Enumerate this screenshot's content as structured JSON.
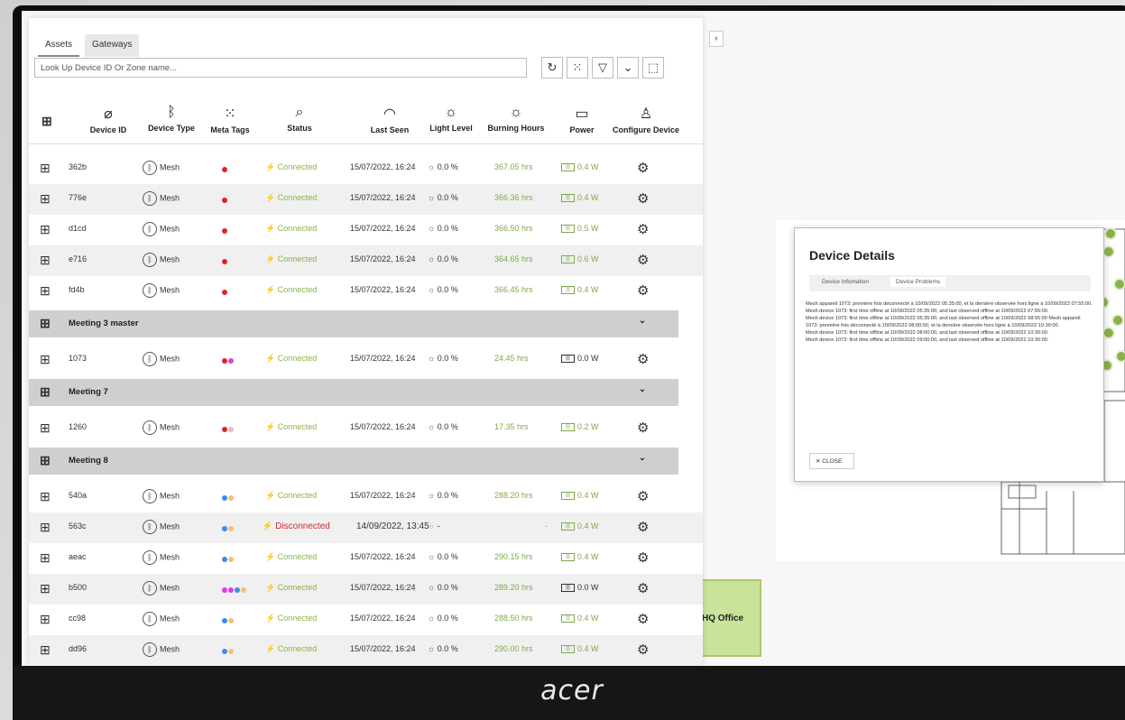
{
  "tabs": [
    "Assets",
    "Gateways"
  ],
  "search": {
    "placeholder": "Look Up Device ID Or Zone name..."
  },
  "columns": [
    "Device ID",
    "Device Type",
    "Meta Tags",
    "Status",
    "Last Seen",
    "Light Level",
    "Burning Hours",
    "Power",
    "Configure Device"
  ],
  "rows": [
    {
      "id": "362b",
      "type": "Mesh",
      "status": "Connected",
      "seen": "15/07/2022, 16:24",
      "light": "0.0 %",
      "hours": "367.05 hrs",
      "power": "0.4 W"
    },
    {
      "id": "776e",
      "type": "Mesh",
      "status": "Connected",
      "seen": "15/07/2022, 16:24",
      "light": "0.0 %",
      "hours": "366.36 hrs",
      "power": "0.4 W"
    },
    {
      "id": "d1cd",
      "type": "Mesh",
      "status": "Connected",
      "seen": "15/07/2022, 16:24",
      "light": "0.0 %",
      "hours": "366.50 hrs",
      "power": "0.5 W"
    },
    {
      "id": "e716",
      "type": "Mesh",
      "status": "Connected",
      "seen": "15/07/2022, 16:24",
      "light": "0.0 %",
      "hours": "364.65 hrs",
      "power": "0.6 W"
    },
    {
      "id": "fd4b",
      "type": "Mesh",
      "status": "Connected",
      "seen": "15/07/2022, 16:24",
      "light": "0.0 %",
      "hours": "366.45 hrs",
      "power": "0.4 W"
    }
  ],
  "zones": [
    "Meeting 3 master",
    "Meeting 7",
    "Meeting 8"
  ],
  "row_1073": {
    "id": "1073",
    "type": "Mesh",
    "status": "Connected",
    "seen": "15/07/2022, 16:24",
    "light": "0.0 %",
    "hours": "24.45 hrs",
    "power": "0.0 W"
  },
  "row_1260": {
    "id": "1260",
    "type": "Mesh",
    "status": "Connected",
    "seen": "15/07/2022, 16:24",
    "light": "0.0 %",
    "hours": "17.35 hrs",
    "power": "0.2 W"
  },
  "rows_m8": [
    {
      "id": "540a",
      "type": "Mesh",
      "status": "Connected",
      "seen": "15/07/2022, 16:24",
      "light": "0.0 %",
      "hours": "288.20 hrs",
      "power": "0.4 W"
    },
    {
      "id": "563c",
      "type": "Mesh",
      "status": "Disconnected",
      "seen": "14/09/2022, 13:45",
      "light": "-",
      "hours": "-",
      "power": "0.4 W"
    },
    {
      "id": "aeac",
      "type": "Mesh",
      "status": "Connected",
      "seen": "15/07/2022, 16:24",
      "light": "0.0 %",
      "hours": "290.15 hrs",
      "power": "0.4 W"
    },
    {
      "id": "b500",
      "type": "Mesh",
      "status": "Connected",
      "seen": "15/07/2022, 16:24",
      "light": "0.0 %",
      "hours": "289.20 hrs",
      "power": "0.0 W"
    },
    {
      "id": "cc98",
      "type": "Mesh",
      "status": "Connected",
      "seen": "15/07/2022, 16:24",
      "light": "0.0 %",
      "hours": "288.50 hrs",
      "power": "0.4 W"
    },
    {
      "id": "dd96",
      "type": "Mesh",
      "status": "Connected",
      "seen": "15/07/2022, 16:24",
      "light": "0.0 %",
      "hours": "290.00 hrs",
      "power": "0.4 W"
    }
  ],
  "dialog": {
    "title": "Device Details",
    "tab_info": "Device Infomation",
    "tab_problems": "Device Problems",
    "lines": [
      "Mesh appareil 1073: première fois déconnecté à 10/09/2022 05:35:00, et la dernière observée hors ligne à 10/09/2022 07:55:00.",
      "Mesh device 1073: first time offline at 10/09/2022 05:35:00, and last observed offline at 10/09/2022 07:55:00.",
      "Mesh device 1073: first time offline at 10/09/2022 05:35:00, and last observed offline at 10/09/2022 08:55:00 Mesh appareil 1073: première fois déconnecté à 10/09/2022 08:00:00, et la dernière observée hors ligne à 10/09/2022 10:30:00.",
      "Mesh device 1073: first time offline at 10/09/2022 08:00:00, and last observed offline at 10/09/2022 10:30:00.",
      "Mesh device 1073: first time offline at 10/09/2022 09:00:00, and last observed offline at 10/09/2022 10:30:00."
    ],
    "close_label": "CLOSE"
  },
  "minimap_label": "HQ Office",
  "brand": "acer",
  "colors": {
    "connected": "#8ab34a",
    "disconnected": "#d62828",
    "zone_bg": "#cfcfcf"
  }
}
